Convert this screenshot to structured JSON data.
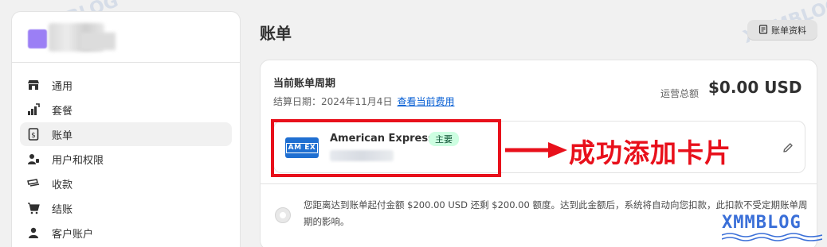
{
  "sidebar": {
    "items": [
      {
        "label": "通用",
        "icon": "store-icon"
      },
      {
        "label": "套餐",
        "icon": "plan-icon"
      },
      {
        "label": "账单",
        "icon": "billing-icon",
        "active": true
      },
      {
        "label": "用户和权限",
        "icon": "users-icon"
      },
      {
        "label": "收款",
        "icon": "payments-icon"
      },
      {
        "label": "结账",
        "icon": "cart-icon"
      },
      {
        "label": "客户账户",
        "icon": "customer-icon"
      }
    ]
  },
  "header": {
    "title": "账单",
    "profile_button": "账单资料"
  },
  "billing_cycle": {
    "title": "当前账单周期",
    "date_label": "结算日期：2024年11月4日",
    "view_fees_link": "查看当前费用",
    "total_label": "运营总额",
    "total_value": "$0.00 USD"
  },
  "payment_method": {
    "card_name": "American Express",
    "badge": "主要",
    "logo_text": "AM EX"
  },
  "threshold": {
    "text": "您距离达到账单起付金额 $200.00 USD 还剩 $200.00 额度。达到此金额后，系统将自动向您扣款，此扣款不受定期账单周期的影响。"
  },
  "annotation": {
    "text": "成功添加卡片"
  },
  "watermark": {
    "text": "XMMBLOG"
  },
  "colors": {
    "annotation_red": "#e8101b",
    "link_blue": "#005bd3",
    "badge_green_bg": "#cdfee1",
    "amex_blue": "#1f6fd1"
  }
}
